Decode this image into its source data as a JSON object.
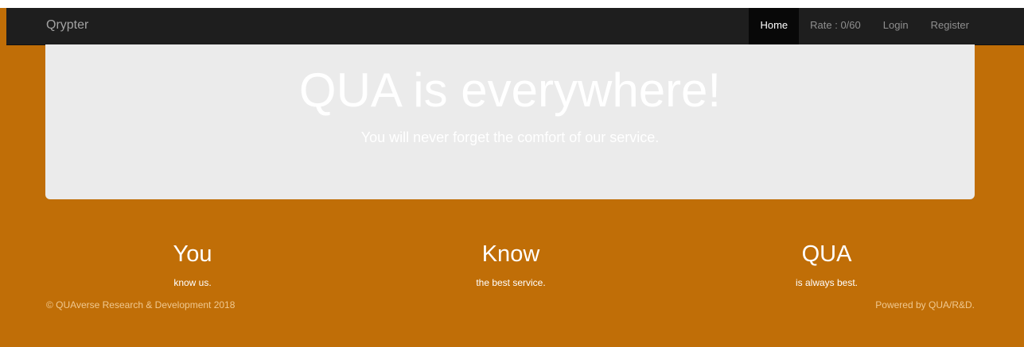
{
  "navbar": {
    "brand": "Qrypter",
    "links": [
      {
        "label": "Home",
        "active": true
      },
      {
        "label": "Rate : 0/60",
        "active": false
      },
      {
        "label": "Login",
        "active": false
      },
      {
        "label": "Register",
        "active": false
      }
    ]
  },
  "jumbotron": {
    "title": "QUA is everywhere!",
    "subtitle": "You will never forget the comfort of our service."
  },
  "columns": [
    {
      "heading": "You",
      "text": "know us."
    },
    {
      "heading": "Know",
      "text": "the best service."
    },
    {
      "heading": "QUA",
      "text": "is always best."
    }
  ],
  "footer": {
    "copyright": "© QUAverse Research & Development 2018",
    "powered": "Powered by QUA/R&D."
  },
  "colors": {
    "background": "#c06e07",
    "navbar": "#1e1e1e",
    "jumbotron": "#ebebeb"
  }
}
